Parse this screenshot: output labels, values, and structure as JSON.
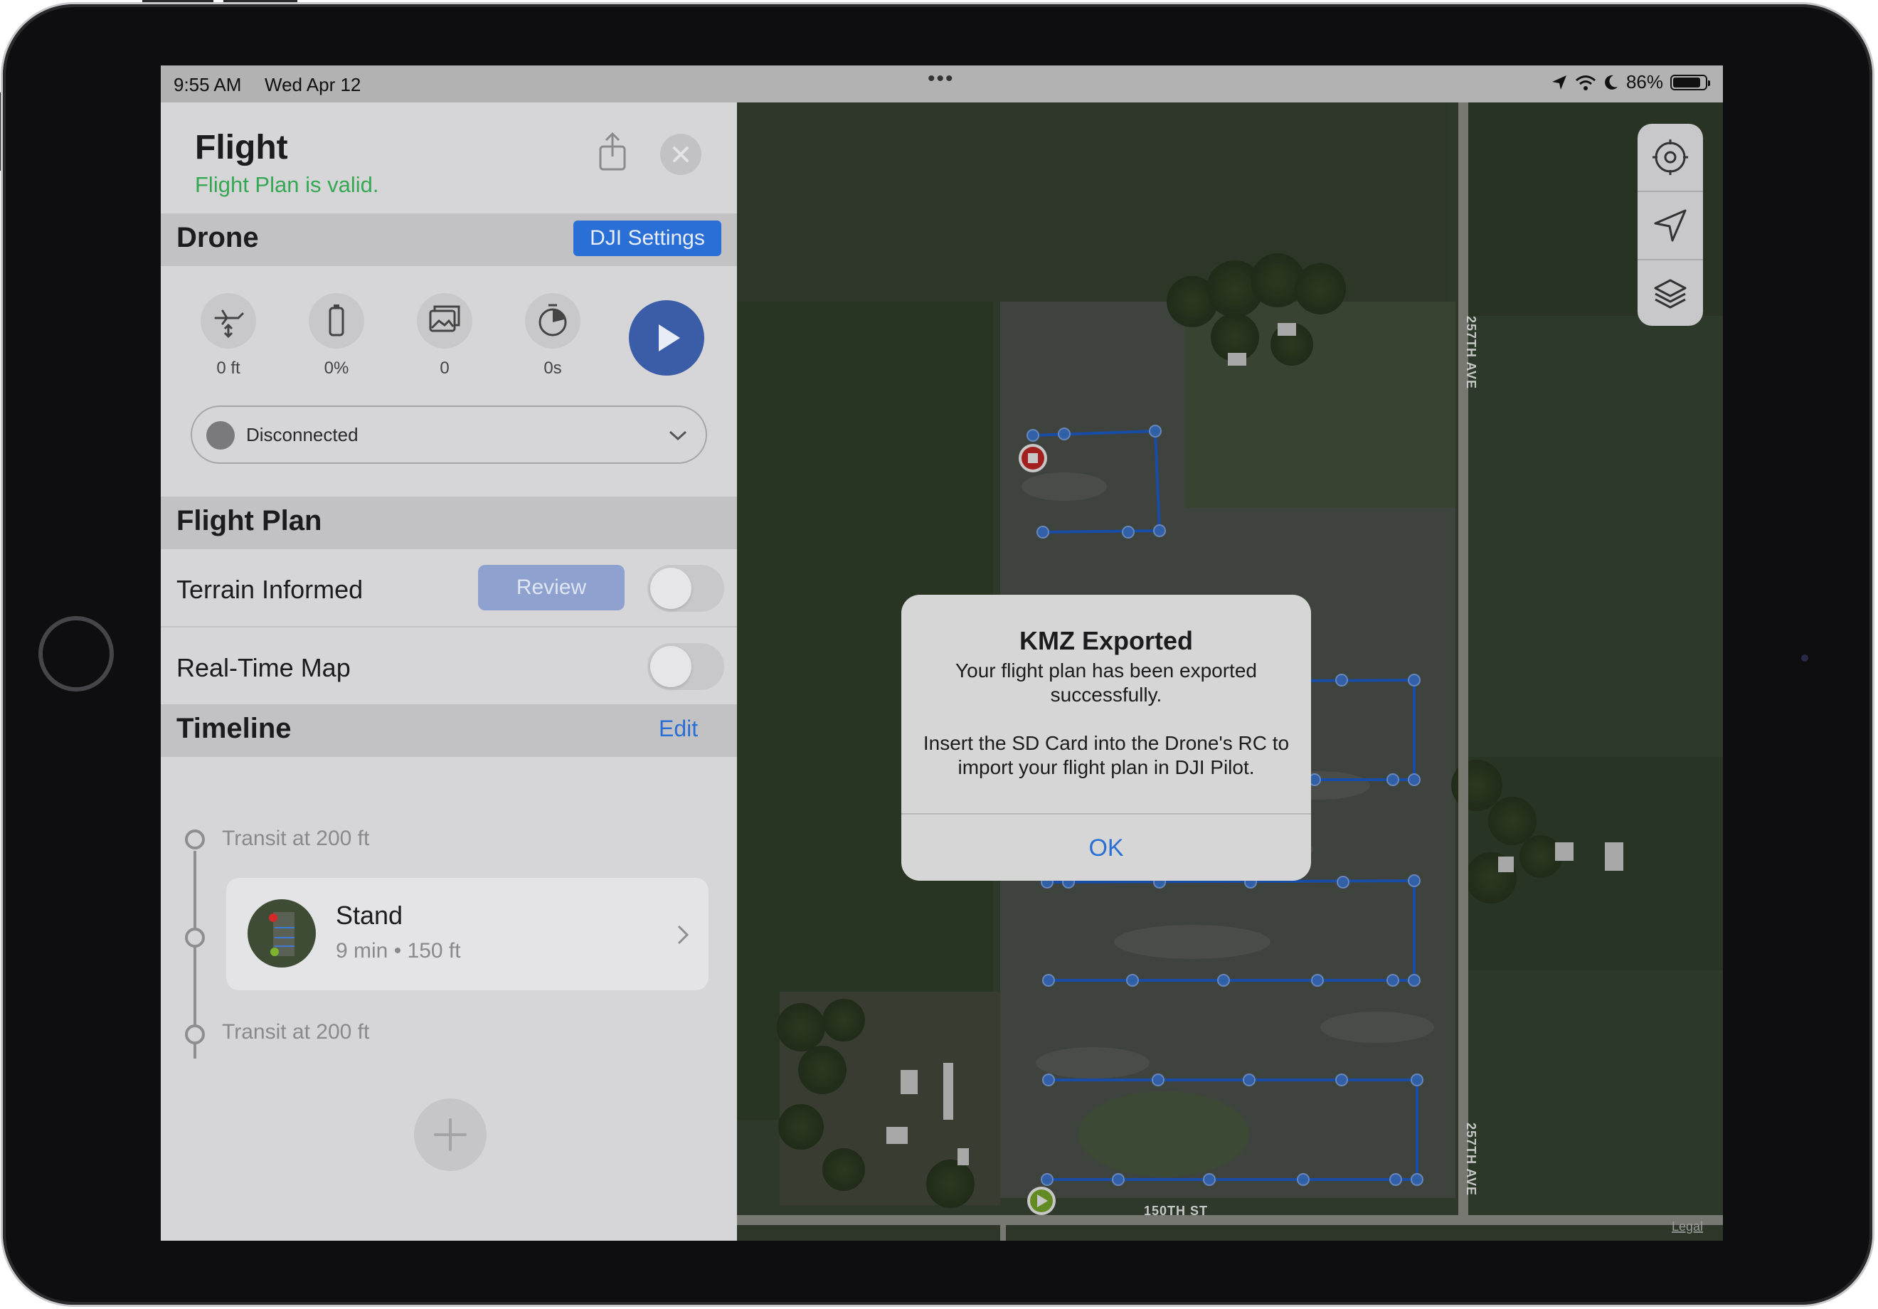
{
  "status_bar": {
    "time": "9:55 AM",
    "date": "Wed Apr 12",
    "battery_percent": "86%",
    "battery_level": 0.86
  },
  "header": {
    "title": "Flight",
    "subtitle": "Flight Plan is valid.",
    "share_icon": "share-icon",
    "close_icon": "close-icon"
  },
  "drone": {
    "title": "Drone",
    "settings_button": "DJI Settings",
    "stats": [
      {
        "icon": "altitude-icon",
        "value": "0 ft"
      },
      {
        "icon": "battery-icon",
        "value": "0%"
      },
      {
        "icon": "photos-icon",
        "value": "0"
      },
      {
        "icon": "timer-icon",
        "value": "0s"
      }
    ],
    "play_icon": "play-icon",
    "connection": "Disconnected"
  },
  "flight_plan": {
    "title": "Flight Plan",
    "terrain_label": "Terrain Informed",
    "review_button": "Review",
    "realtime_label": "Real-Time Map"
  },
  "timeline": {
    "title": "Timeline",
    "edit_button": "Edit",
    "transit_top": "Transit at 200 ft",
    "stand_name": "Stand",
    "stand_detail": "9 min • 150 ft",
    "transit_bottom": "Transit at 200 ft"
  },
  "dialog": {
    "title": "KMZ Exported",
    "message_line1": "Your flight plan has been exported successfully.",
    "message_line2": "Insert the SD Card into the Drone's RC to import your flight plan in DJI Pilot.",
    "ok_button": "OK"
  },
  "map": {
    "road_label_vertical": "257TH AVE",
    "road_label_horizontal": "150TH ST",
    "legal_label": "Legal",
    "tools": [
      "settings-icon",
      "location-arrow-icon",
      "layers-icon"
    ]
  },
  "colors": {
    "accent": "#2a6fd6",
    "valid_green": "#34a853",
    "route_blue": "#1f63d6"
  }
}
